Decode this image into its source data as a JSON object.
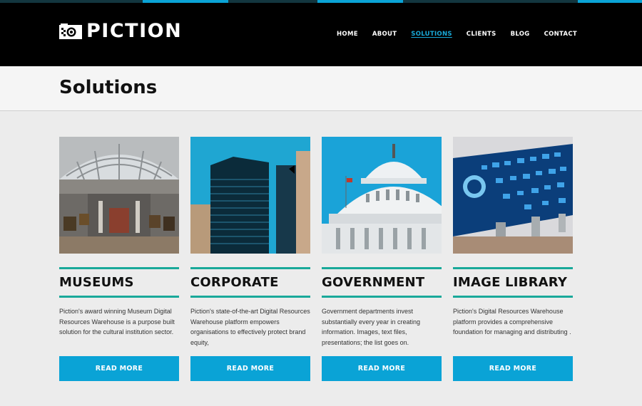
{
  "brand": {
    "name": "PICTION",
    "accent": "#0aa3d6",
    "teal": "#19a99a",
    "logo_icon": "camera-icon"
  },
  "nav": [
    {
      "label": "HOME",
      "active": false
    },
    {
      "label": "ABOUT",
      "active": false
    },
    {
      "label": "SOLUTIONS",
      "active": true
    },
    {
      "label": "CLIENTS",
      "active": false
    },
    {
      "label": "BLOG",
      "active": false
    },
    {
      "label": "CONTACT",
      "active": false
    }
  ],
  "page": {
    "title": "Solutions"
  },
  "cards": [
    {
      "title": "MUSEUMS",
      "image": "museum-gallery-image",
      "description": "Piction's award winning Museum Digital Resources Warehouse is a purpose built solution for the cultural institution sector.",
      "button": "READ MORE"
    },
    {
      "title": "CORPORATE",
      "image": "corporate-building-image",
      "description": "Piction's state-of-the-art Digital Resources Warehouse platform empowers organisations to effectively protect brand equity,",
      "button": "READ MORE"
    },
    {
      "title": "GOVERNMENT",
      "image": "capitol-dome-image",
      "description": "Government departments invest substantially every year in creating information. Images, text files, presentations; the list goes on.",
      "button": "READ MORE"
    },
    {
      "title": "IMAGE LIBRARY",
      "image": "digital-wall-image",
      "description": "Piction's Digital Resources Warehouse platform provides a comprehensive foundation for managing and distributing .",
      "button": "READ MORE"
    }
  ]
}
